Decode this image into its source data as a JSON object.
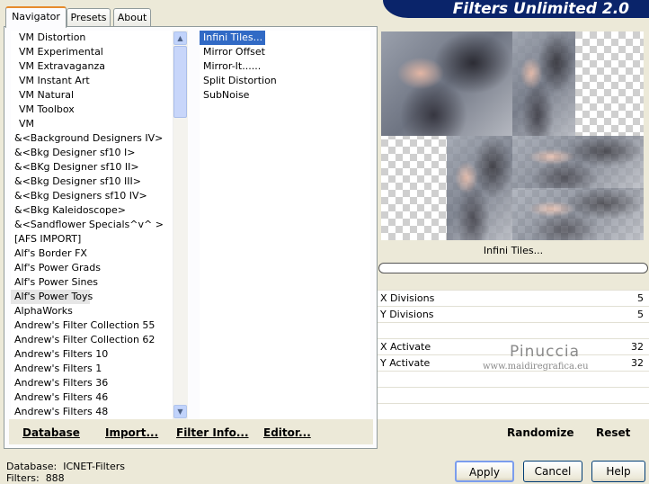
{
  "tabs": [
    "Navigator",
    "Presets",
    "About"
  ],
  "banner_title": "Filters Unlimited 2.0",
  "categories": [
    "VM Distortion",
    "VM Experimental",
    "VM Extravaganza",
    "VM Instant Art",
    "VM Natural",
    "VM Toolbox",
    "VM",
    "&<Background Designers IV>",
    "&<Bkg Designer sf10 I>",
    "&<BKg Designer sf10 II>",
    "&<Bkg Designer sf10 III>",
    "&<Bkg Designers sf10 IV>",
    "&<Bkg Kaleidoscope>",
    "&<Sandflower Specials^v^ >",
    "[AFS IMPORT]",
    "Alf's Border FX",
    "Alf's Power Grads",
    "Alf's Power Sines",
    "Alf's Power Toys",
    "AlphaWorks",
    "Andrew's Filter Collection 55",
    "Andrew's Filter Collection 62",
    "Andrew's Filters 10",
    "Andrew's Filters 1",
    "Andrew's Filters 36",
    "Andrew's Filters 46",
    "Andrew's Filters 48"
  ],
  "selected_category_index": 18,
  "filters": [
    "Infini Tiles...",
    "Mirror Offset",
    "Mirror-It......",
    "Split Distortion",
    "SubNoise"
  ],
  "selected_filter_index": 0,
  "left_buttons": {
    "database": "Database",
    "import": "Import...",
    "filter_info": "Filter Info...",
    "editor": "Editor..."
  },
  "current_filter_label": "Infini Tiles...",
  "params": [
    {
      "label": "X Divisions",
      "value": "5"
    },
    {
      "label": "Y Divisions",
      "value": "5"
    },
    {
      "label": "X Activate",
      "value": "32"
    },
    {
      "label": "Y Activate",
      "value": "32"
    }
  ],
  "right_buttons": {
    "randomize": "Randomize",
    "reset": "Reset"
  },
  "status": {
    "database_label": "Database:",
    "database_value": "ICNET-Filters",
    "filters_label": "Filters:",
    "filters_value": "888"
  },
  "dialog_buttons": {
    "apply": "Apply",
    "cancel": "Cancel",
    "help": "Help"
  },
  "watermark": {
    "line1": "Pinuccia",
    "line2": "www.maidiregrafica.eu"
  }
}
